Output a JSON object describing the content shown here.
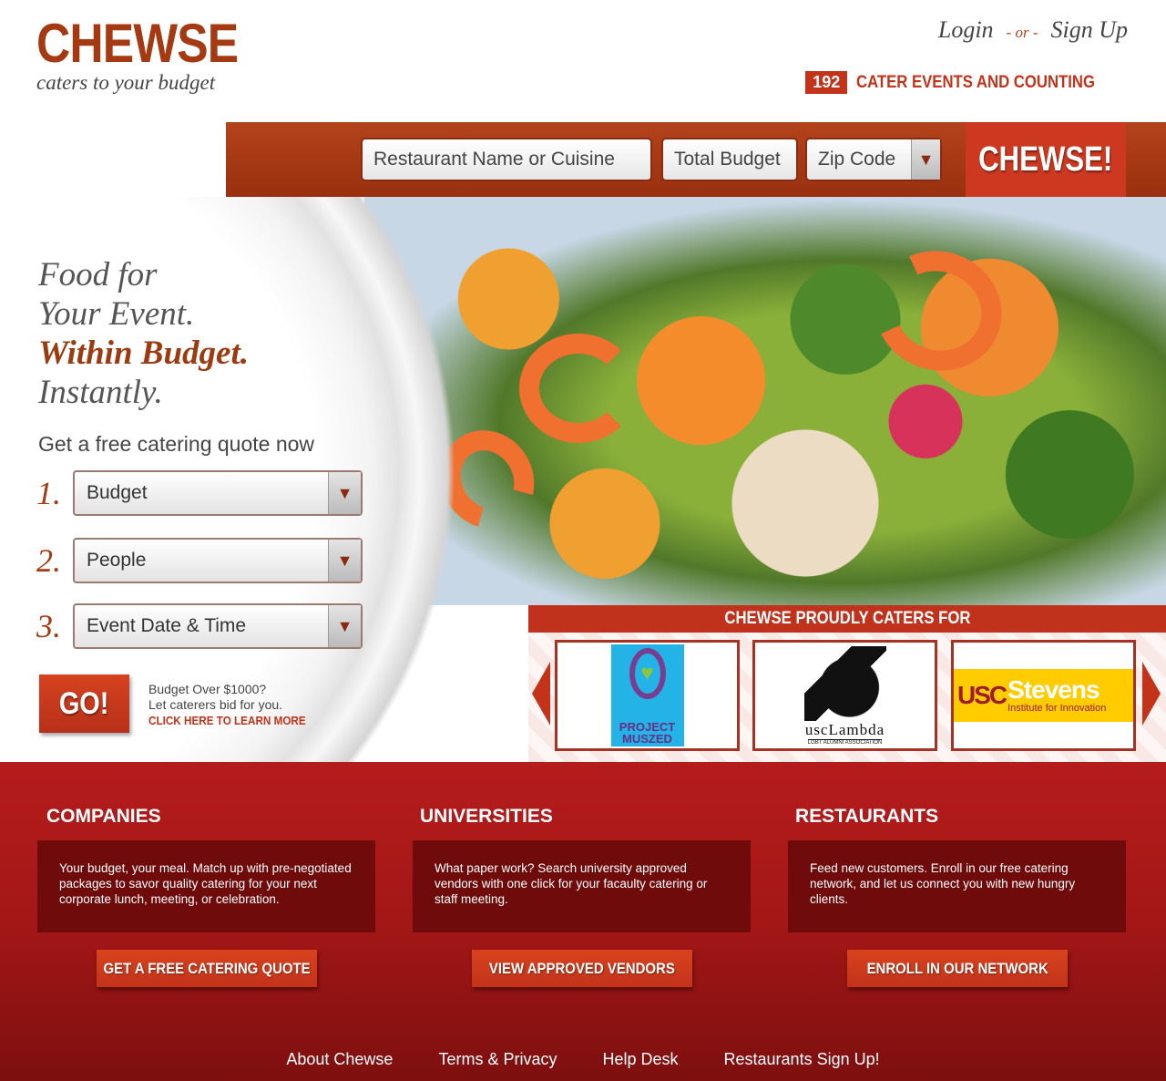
{
  "header": {
    "logo": "CHEWSE",
    "tagline": "caters to your budget",
    "login": "Login",
    "or": "- or -",
    "signup": "Sign Up",
    "counter_number": "192",
    "counter_label": "CATER EVENTS AND COUNTING"
  },
  "search": {
    "restaurant_placeholder": "Restaurant Name or Cuisine",
    "budget_placeholder": "Total Budget",
    "zip_placeholder": "Zip Code",
    "button": "CHEWSE!"
  },
  "hero": {
    "line1": "Food for",
    "line2": "Your Event.",
    "line3": "Within Budget.",
    "line4": "Instantly.",
    "quote_title": "Get a free catering quote now",
    "steps": [
      {
        "number": "1.",
        "label": "Budget"
      },
      {
        "number": "2.",
        "label": "People"
      },
      {
        "number": "3.",
        "label": "Event Date & Time"
      }
    ],
    "go_button": "GO!",
    "bid_line1": "Budget Over $1000?",
    "bid_line2": "Let caterers bid for you.",
    "bid_link": "CLICK HERE TO LEARN MORE"
  },
  "caters": {
    "title": "CHEWSE PROUDLY CATERS FOR",
    "partners": [
      {
        "name": "PROJECT MUSZED"
      },
      {
        "name": "uscLambda",
        "sub": "LGBT ALUMNI ASSOCIATION"
      },
      {
        "name_left": "USC",
        "name_right": "Stevens",
        "sub": "Institute for Innovation"
      }
    ]
  },
  "columns": [
    {
      "title": "COMPANIES",
      "text": "Your budget, your meal. Match up with pre-negotiated packages to savor quality catering for your next corporate lunch, meeting, or celebration.",
      "button": "GET A FREE CATERING QUOTE"
    },
    {
      "title": "UNIVERSITIES",
      "text": "What paper work? Search university approved vendors  with one click for your facaulty catering or staff meeting.",
      "button": "VIEW APPROVED VENDORS"
    },
    {
      "title": "RESTAURANTS",
      "text": "Feed new customers. Enroll in our free catering network, and let us connect you with new hungry clients.",
      "button": "ENROLL IN OUR NETWORK"
    }
  ],
  "footer": {
    "links": [
      "About Chewse",
      "Terms & Privacy",
      "Help Desk",
      "Restaurants Sign Up!"
    ]
  },
  "colors": {
    "brand": "#a53a12",
    "accent": "#c3331a",
    "dark_red": "#6f0b0b"
  },
  "icons": {
    "dropdown": "triangle-down-icon",
    "carousel_prev": "arrow-left-icon",
    "carousel_next": "arrow-right-icon"
  }
}
